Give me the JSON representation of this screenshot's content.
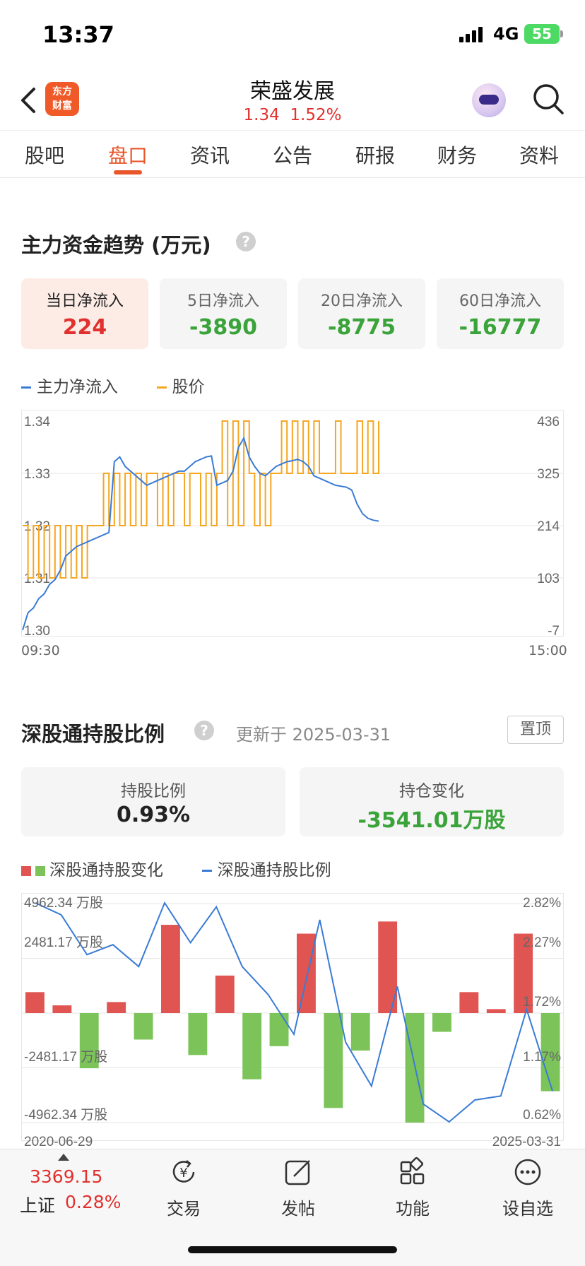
{
  "status_bar": {
    "time": "13:37",
    "network": "4G",
    "battery": "55"
  },
  "header": {
    "logo_text_line1": "东方",
    "logo_text_line2": "财富",
    "stock_name": "荣盛发展",
    "price": "1.34",
    "change_pct": "1.52%"
  },
  "tabs": [
    {
      "label": "股吧"
    },
    {
      "label": "盘口",
      "active": true
    },
    {
      "label": "资讯"
    },
    {
      "label": "公告"
    },
    {
      "label": "研报"
    },
    {
      "label": "财务"
    },
    {
      "label": "资料"
    }
  ],
  "fund_flow": {
    "title": "主力资金趋势 (万元)",
    "help_icon": "?",
    "cards": [
      {
        "label": "当日净流入",
        "value": "224",
        "tone": "red"
      },
      {
        "label": "5日净流入",
        "value": "-3890",
        "tone": "green"
      },
      {
        "label": "20日净流入",
        "value": "-8775",
        "tone": "green"
      },
      {
        "label": "60日净流入",
        "value": "-16777",
        "tone": "green"
      }
    ],
    "legend": {
      "flow": "主力净流入",
      "price": "股价"
    },
    "colors": {
      "flow": "#3a7bd5",
      "price": "#f5a623"
    }
  },
  "hk_connect": {
    "title": "深股通持股比例",
    "help_icon": "?",
    "updated": "更新于 2025-03-31",
    "pin_label": "置顶",
    "ratio_label": "持股比例",
    "ratio_value": "0.93%",
    "change_label": "持仓变化",
    "change_value": "-3541.01万股",
    "legend": {
      "bars": "深股通持股变化",
      "line": "深股通持股比例"
    },
    "colors": {
      "up": "#e05552",
      "down": "#7cc45a",
      "line": "#3a7bd5"
    }
  },
  "chart_data": [
    {
      "type": "line",
      "x_start": "09:30",
      "x_end": "15:00",
      "y_left_ticks": [
        "1.34",
        "1.33",
        "1.32",
        "1.31",
        "1.30"
      ],
      "y_right_ticks": [
        "436",
        "325",
        "214",
        "103",
        "-7"
      ],
      "ylim_left": [
        1.3,
        1.34
      ],
      "ylim_right": [
        -7,
        436
      ],
      "series": [
        {
          "name": "主力净流入",
          "axis": "right",
          "values": [
            -7,
            30,
            40,
            60,
            70,
            90,
            100,
            120,
            150,
            160,
            170,
            175,
            180,
            185,
            190,
            195,
            200,
            350,
            360,
            340,
            330,
            320,
            310,
            300,
            305,
            310,
            315,
            320,
            325,
            330,
            330,
            340,
            350,
            355,
            360,
            362,
            300,
            305,
            310,
            330,
            380,
            400,
            360,
            340,
            325,
            320,
            330,
            340,
            345,
            350,
            352,
            355,
            350,
            340,
            320,
            315,
            310,
            305,
            300,
            298,
            296,
            290,
            260,
            240,
            230,
            226,
            224
          ]
        },
        {
          "name": "股价",
          "axis": "left",
          "values": [
            1.32,
            1.31,
            1.32,
            1.31,
            1.32,
            1.31,
            1.32,
            1.31,
            1.32,
            1.31,
            1.32,
            1.31,
            1.32,
            1.32,
            1.32,
            1.33,
            1.32,
            1.33,
            1.32,
            1.33,
            1.32,
            1.33,
            1.32,
            1.33,
            1.33,
            1.32,
            1.33,
            1.32,
            1.33,
            1.33,
            1.32,
            1.33,
            1.33,
            1.32,
            1.33,
            1.32,
            1.33,
            1.34,
            1.32,
            1.34,
            1.32,
            1.34,
            1.33,
            1.32,
            1.33,
            1.32,
            1.33,
            1.33,
            1.34,
            1.33,
            1.34,
            1.33,
            1.34,
            1.33,
            1.34,
            1.33,
            1.33,
            1.33,
            1.34,
            1.33,
            1.33,
            1.33,
            1.34,
            1.33,
            1.34,
            1.33,
            1.34
          ]
        }
      ]
    },
    {
      "type": "bar",
      "x_start": "2020-06-29",
      "x_end": "2025-03-31",
      "y_left_ticks": [
        "4962.34 万股",
        "2481.17 万股",
        "-2481.17 万股",
        "-4962.34 万股"
      ],
      "y_right_ticks": [
        "2.82%",
        "2.27%",
        "1.72%",
        "1.17%",
        "0.62%"
      ],
      "ylim_left": [
        -4962.34,
        4962.34
      ],
      "ylim_right": [
        0.62,
        2.82
      ],
      "series": [
        {
          "name": "深股通持股变化",
          "values": [
            950,
            350,
            -2500,
            500,
            -1200,
            4000,
            -1900,
            1700,
            -3000,
            -1500,
            3600,
            -4300,
            -1700,
            4150,
            -4962,
            -850,
            950,
            180,
            3600,
            -3541
          ]
        },
        {
          "name": "深股通持股比例",
          "values": [
            2.82,
            2.7,
            2.3,
            2.4,
            2.18,
            2.82,
            2.42,
            2.78,
            2.18,
            1.9,
            1.5,
            2.65,
            1.42,
            0.98,
            1.98,
            0.8,
            0.62,
            0.84,
            0.88,
            1.75,
            0.93
          ]
        }
      ]
    }
  ],
  "bottom_bar": {
    "index_value": "3369.15",
    "index_name": "上证",
    "index_change": "0.28%",
    "nav": [
      {
        "label": "交易",
        "icon": "trade-icon"
      },
      {
        "label": "发帖",
        "icon": "compose-icon"
      },
      {
        "label": "功能",
        "icon": "grid-icon"
      },
      {
        "label": "设自选",
        "icon": "more-icon"
      }
    ]
  }
}
